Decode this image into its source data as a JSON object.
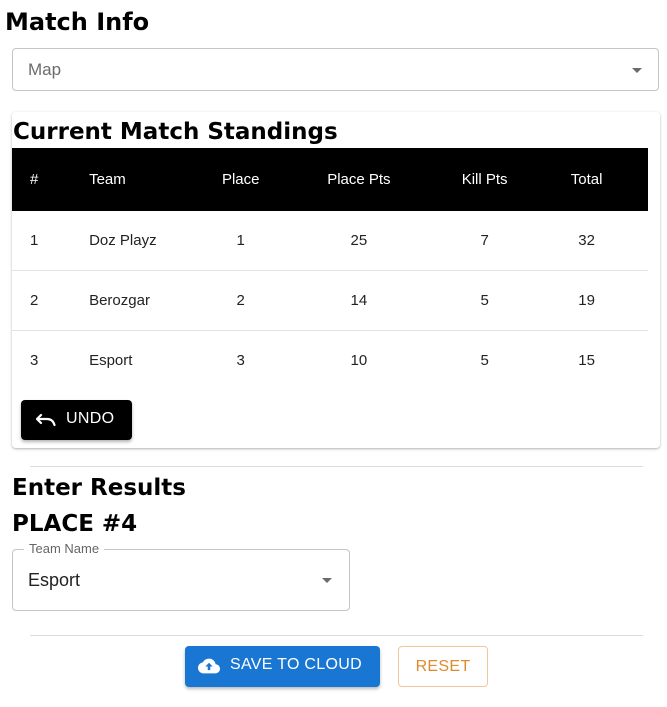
{
  "match_info": {
    "title": "Match Info",
    "map_select": {
      "placeholder": "Map",
      "icon": "chevron-down-icon"
    }
  },
  "standings": {
    "title": "Current Match Standings",
    "columns": [
      "#",
      "Team",
      "Place",
      "Place Pts",
      "Kill Pts",
      "Total"
    ],
    "rows": [
      [
        "1",
        "Doz Playz",
        "1",
        "25",
        "7",
        "32"
      ],
      [
        "2",
        "Berozgar",
        "2",
        "14",
        "5",
        "19"
      ],
      [
        "3",
        "Esport",
        "3",
        "10",
        "5",
        "15"
      ]
    ],
    "undo_label": "UNDO",
    "undo_icon": "undo-icon"
  },
  "enter_results": {
    "title": "Enter Results",
    "place_heading": "PLACE #4",
    "team_select": {
      "label": "Team Name",
      "value": "Esport",
      "icon": "chevron-down-icon"
    }
  },
  "actions": {
    "save_label": "SAVE TO CLOUD",
    "save_icon": "cloud-upload-icon",
    "reset_label": "RESET"
  },
  "colors": {
    "primary": "#1976d2",
    "reset_accent": "#e08a2c",
    "table_header_bg": "#000000"
  }
}
